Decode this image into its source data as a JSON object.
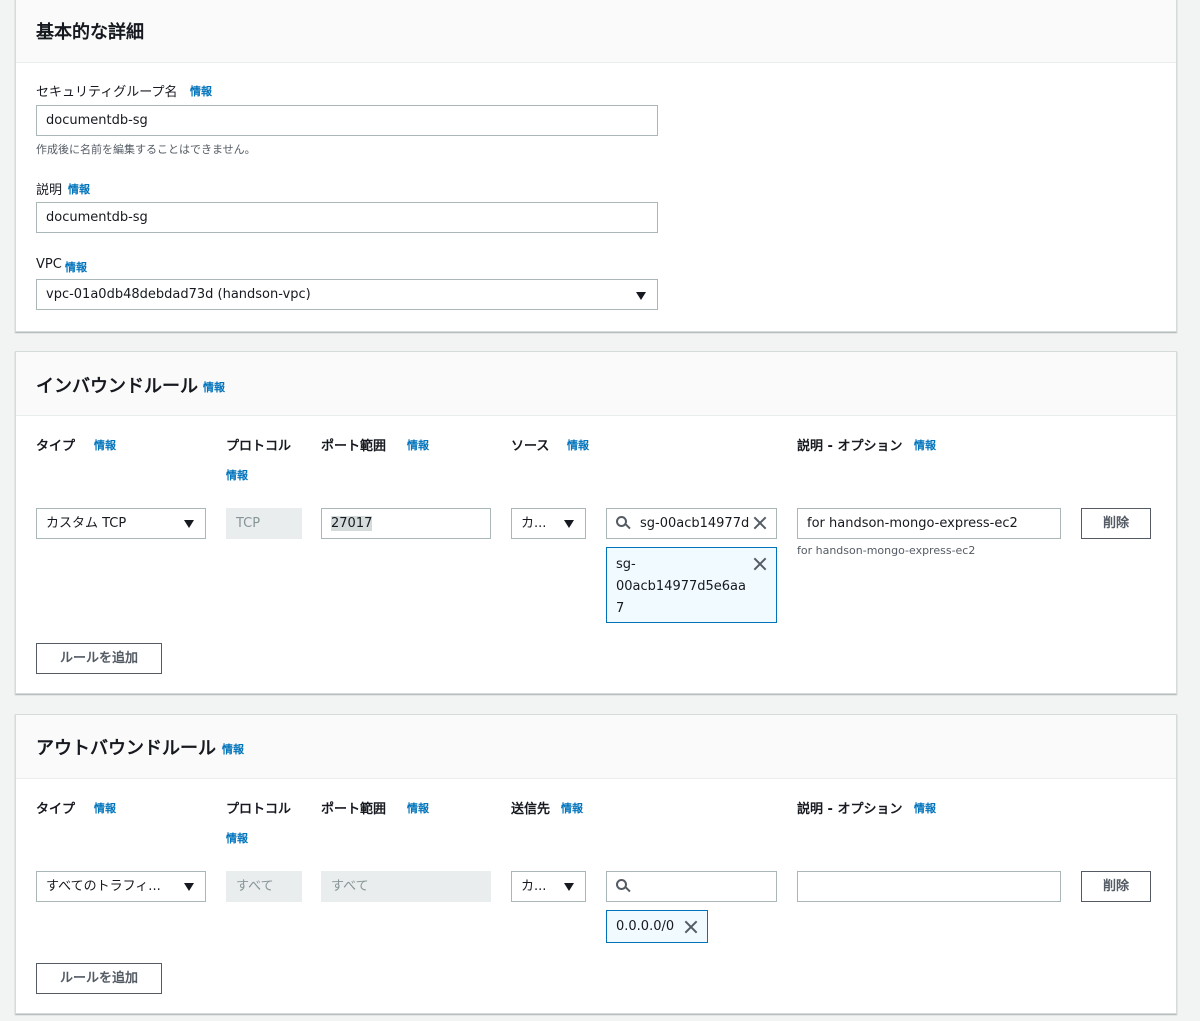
{
  "basic": {
    "title": "基本的な詳細",
    "sg_name_label": "セキュリティグループ名",
    "sg_name_info": "情報",
    "sg_name_value": "documentdb-sg",
    "sg_name_hint": "作成後に名前を編集することはできません。",
    "desc_label": "説明",
    "desc_info": "情報",
    "desc_value": "documentdb-sg",
    "vpc_label": "VPC",
    "vpc_info": "情報",
    "vpc_value": "vpc-01a0db48debdad73d (handson-vpc)"
  },
  "inbound": {
    "title": "インバウンドルール",
    "title_info": "情報",
    "col_type": "タイプ",
    "col_type_info": "情報",
    "col_protocol": "プロトコル",
    "col_protocol_info": "情報",
    "col_port": "ポート範囲",
    "col_port_info": "情報",
    "col_source": "ソース",
    "col_source_info": "情報",
    "col_desc": "説明 - オプション",
    "col_desc_info": "情報",
    "row": {
      "type": "カスタム TCP",
      "protocol": "TCP",
      "port": "27017",
      "source_mode": "カ...",
      "source_search": "sg-00acb14977d",
      "token_line1": "sg-",
      "token_line2": "00acb14977d5e6aa",
      "token_line3": "7",
      "description": "for handson-mongo-express-ec2",
      "description_hint": "for handson-mongo-express-ec2",
      "delete_label": "削除"
    },
    "add_rule_label": "ルールを追加"
  },
  "outbound": {
    "title": "アウトバウンドルール",
    "title_info": "情報",
    "col_type": "タイプ",
    "col_type_info": "情報",
    "col_protocol": "プロトコル",
    "col_protocol_info": "情報",
    "col_port": "ポート範囲",
    "col_port_info": "情報",
    "col_dest": "送信先",
    "col_dest_info": "情報",
    "col_desc": "説明 - オプション",
    "col_desc_info": "情報",
    "row": {
      "type": "すべてのトラフィ...",
      "protocol": "すべて",
      "port": "すべて",
      "dest_mode": "カ...",
      "dest_search": "",
      "token": "0.0.0.0/0",
      "description": "",
      "delete_label": "削除"
    },
    "add_rule_label": "ルールを追加"
  },
  "colors": {
    "link": "#0073bb",
    "panel_header": "#fafafa",
    "page_bg": "#f2f3f3",
    "token_bg": "#f1faff"
  }
}
